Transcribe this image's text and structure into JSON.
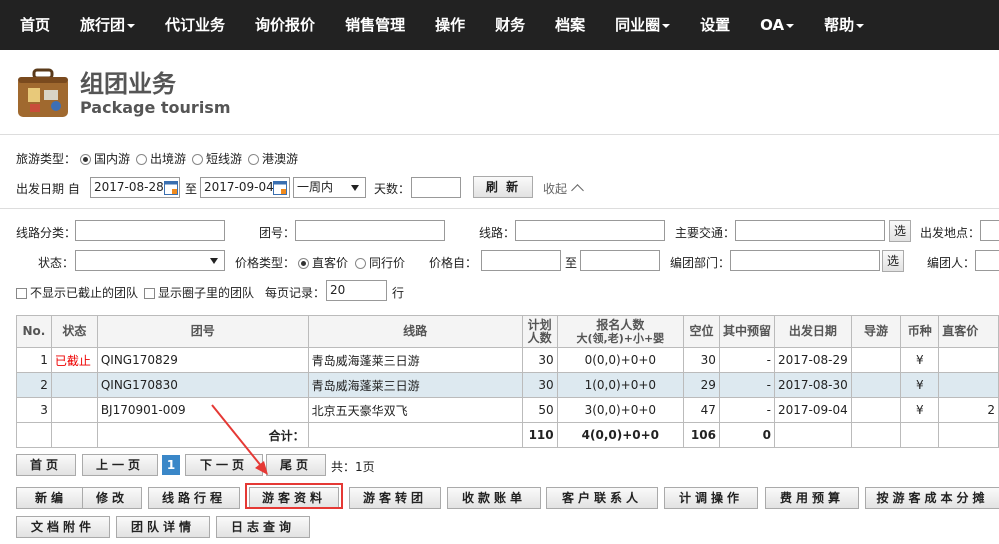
{
  "nav": {
    "items": [
      {
        "label": "首页",
        "caret": false
      },
      {
        "label": "旅行团",
        "caret": true
      },
      {
        "label": "代订业务",
        "caret": false
      },
      {
        "label": "询价报价",
        "caret": false
      },
      {
        "label": "销售管理",
        "caret": false
      },
      {
        "label": "操作",
        "caret": false
      },
      {
        "label": "财务",
        "caret": false
      },
      {
        "label": "档案",
        "caret": false
      },
      {
        "label": "同业圈",
        "caret": true
      },
      {
        "label": "设置",
        "caret": false
      },
      {
        "label": "OA",
        "caret": true
      },
      {
        "label": "帮助",
        "caret": true
      }
    ]
  },
  "header": {
    "title": "组团业务",
    "subtitle": "Package tourism"
  },
  "filters": {
    "tour_type_label": "旅游类型：",
    "tour_types": [
      {
        "label": "国内游",
        "selected": true
      },
      {
        "label": "出境游",
        "selected": false
      },
      {
        "label": "短线游",
        "selected": false
      },
      {
        "label": "港澳游",
        "selected": false
      }
    ],
    "date_label": "出发日期 自",
    "date_from": "2017-08-28",
    "to_label": "至",
    "date_to": "2017-09-04",
    "range_select": "一周内",
    "days_label": "天数：",
    "days_value": "",
    "refresh_label": "刷 新",
    "collapse_label": "收起",
    "route_category_label": "线路分类：",
    "group_no_label": "团号：",
    "route_label": "线路：",
    "transport_label": "主要交通：",
    "select_btn": "选",
    "depart_place_label": "出发地点：",
    "status_label": "状态：",
    "price_type_label": "价格类型：",
    "price_types": [
      {
        "label": "直客价",
        "selected": true
      },
      {
        "label": "同行价",
        "selected": false
      }
    ],
    "price_from_label": "价格自：",
    "price_to_label": "至",
    "dept_label": "编团部门：",
    "editor_label": "编团人：",
    "hide_closed_label": "不显示已截止的团队",
    "show_circle_label": "显示圈子里的团队",
    "per_page_label": "每页记录：",
    "per_page_value": "20",
    "rows_unit": "行"
  },
  "table": {
    "headers": [
      "No.",
      "状态",
      "团号",
      "线路",
      "计划人数",
      "报名人数",
      "空位",
      "其中预留",
      "出发日期",
      "导游",
      "币种",
      "直客价"
    ],
    "signup_sub": "大(领,老)+小+婴",
    "rows": [
      {
        "no": "1",
        "status": "已截止",
        "group": "QING170829",
        "route": "青岛威海蓬莱三日游",
        "plan": "30",
        "signup": "0(0,0)+0+0",
        "vacant": "30",
        "reserved": "-",
        "date": "2017-08-29",
        "guide": "",
        "currency": "¥",
        "price": ""
      },
      {
        "no": "2",
        "status": "",
        "group": "QING170830",
        "route": "青岛威海蓬莱三日游",
        "plan": "30",
        "signup": "1(0,0)+0+0",
        "vacant": "29",
        "reserved": "-",
        "date": "2017-08-30",
        "guide": "",
        "currency": "¥",
        "price": ""
      },
      {
        "no": "3",
        "status": "",
        "group": "BJ170901-009",
        "route": "北京五天豪华双飞",
        "plan": "50",
        "signup": "3(0,0)+0+0",
        "vacant": "47",
        "reserved": "-",
        "date": "2017-09-04",
        "guide": "",
        "currency": "¥",
        "price": "2"
      }
    ],
    "total_label": "合计：",
    "total_plan": "110",
    "total_signup": "4(0,0)+0+0",
    "total_vacant": "106",
    "total_reserved": "0"
  },
  "pager": {
    "first": "首页",
    "prev": "上一页",
    "current": "1",
    "next": "下一页",
    "last": "尾页",
    "total": "共：1页"
  },
  "actions": {
    "row1": [
      "新编",
      "修改",
      "线路行程",
      "游客资料",
      "游客转团",
      "收款账单",
      "客户联系人",
      "计调操作",
      "费用预算",
      "按游客成本分摊"
    ],
    "row2": [
      "文档附件",
      "团队详情",
      "日志查询"
    ]
  }
}
